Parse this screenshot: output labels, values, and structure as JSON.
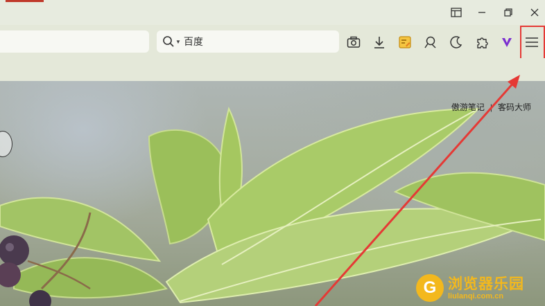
{
  "titlebar": {
    "icons": [
      "sidebar-layout-icon",
      "minimize-icon",
      "restore-icon",
      "close-icon"
    ]
  },
  "toolbar": {
    "address_value": "",
    "search": {
      "engine_label": "百度"
    },
    "icons": [
      "screenshot-icon",
      "download-icon",
      "notes-icon",
      "translate-icon",
      "dark-mode-icon",
      "extensions-icon",
      "vip-icon",
      "menu-icon"
    ]
  },
  "content": {
    "top_links": [
      "傲游笔记",
      "|",
      "客码大师"
    ]
  },
  "watermark": {
    "title": "浏览器乐园",
    "url": "liulanqi.com.cn",
    "logo_letter": "G"
  },
  "annotation": {
    "highlight_color": "#e53935"
  }
}
